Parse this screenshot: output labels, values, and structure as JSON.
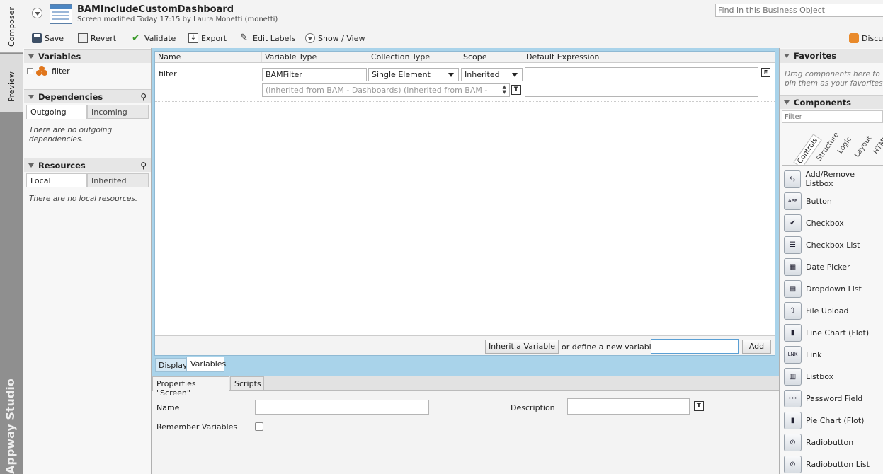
{
  "sidebar_tabs": {
    "composer": "Composer",
    "preview": "Preview",
    "brand": "Appway Studio"
  },
  "header": {
    "title": "BAMIncludeCustomDashboard",
    "subtitle": "Screen modified Today 17:15 by Laura Monetti (monetti)",
    "search_placeholder": "Find in this Business Object"
  },
  "toolbar": {
    "save": "Save",
    "revert": "Revert",
    "validate": "Validate",
    "export": "Export",
    "edit_labels": "Edit Labels",
    "show_view": "Show / View",
    "discuss": "Discuss"
  },
  "left": {
    "variables_title": "Variables",
    "variables_items": [
      "filter"
    ],
    "dependencies_title": "Dependencies",
    "dep_tabs": [
      "Outgoing",
      "Incoming"
    ],
    "dep_empty": "There are no outgoing dependencies.",
    "resources_title": "Resources",
    "res_tabs": [
      "Local",
      "Inherited"
    ],
    "res_empty": "There are no local resources."
  },
  "table": {
    "columns": [
      "Name",
      "Variable Type",
      "Collection Type",
      "Scope",
      "Default Expression"
    ],
    "row": {
      "name": "filter",
      "type": "BAMFilter",
      "collection": "Single Element",
      "scope": "Inherited",
      "hint": "(inherited from BAM - Dashboards) (inherited from BAM -"
    }
  },
  "footer_bar": {
    "inherit_button": "Inherit a Variable",
    "define_label": "or define a new variable:",
    "new_value": "",
    "add_button": "Add"
  },
  "view_tabs": [
    "Display",
    "Variables"
  ],
  "props": {
    "tabs": [
      "Properties \"Screen\"",
      "Scripts"
    ],
    "name_label": "Name",
    "name_value": "",
    "desc_label": "Description",
    "desc_value": "",
    "remember_label": "Remember Variables",
    "remember_checked": false
  },
  "right": {
    "favorites_title": "Favorites",
    "favorites_hint": "Drag components here to pin them as your favorites",
    "components_title": "Components",
    "filter_placeholder": "Filter",
    "categories": [
      "Controls",
      "Structure",
      "Logic",
      "Layout",
      "HTML"
    ],
    "components": [
      {
        "label": "Add/Remove Listbox",
        "icon": "add-remove-listbox-icon"
      },
      {
        "label": "Button",
        "icon": "button-icon"
      },
      {
        "label": "Checkbox",
        "icon": "checkbox-icon"
      },
      {
        "label": "Checkbox List",
        "icon": "checkbox-list-icon"
      },
      {
        "label": "Date Picker",
        "icon": "date-picker-icon"
      },
      {
        "label": "Dropdown List",
        "icon": "dropdown-list-icon"
      },
      {
        "label": "File Upload",
        "icon": "file-upload-icon"
      },
      {
        "label": "Line Chart (Flot)",
        "icon": "line-chart-icon"
      },
      {
        "label": "Link",
        "icon": "link-icon"
      },
      {
        "label": "Listbox",
        "icon": "listbox-icon"
      },
      {
        "label": "Password Field",
        "icon": "password-field-icon"
      },
      {
        "label": "Pie Chart (Flot)",
        "icon": "pie-chart-icon"
      },
      {
        "label": "Radiobutton",
        "icon": "radiobutton-icon"
      },
      {
        "label": "Radiobutton List",
        "icon": "radiobutton-list-icon"
      }
    ]
  }
}
